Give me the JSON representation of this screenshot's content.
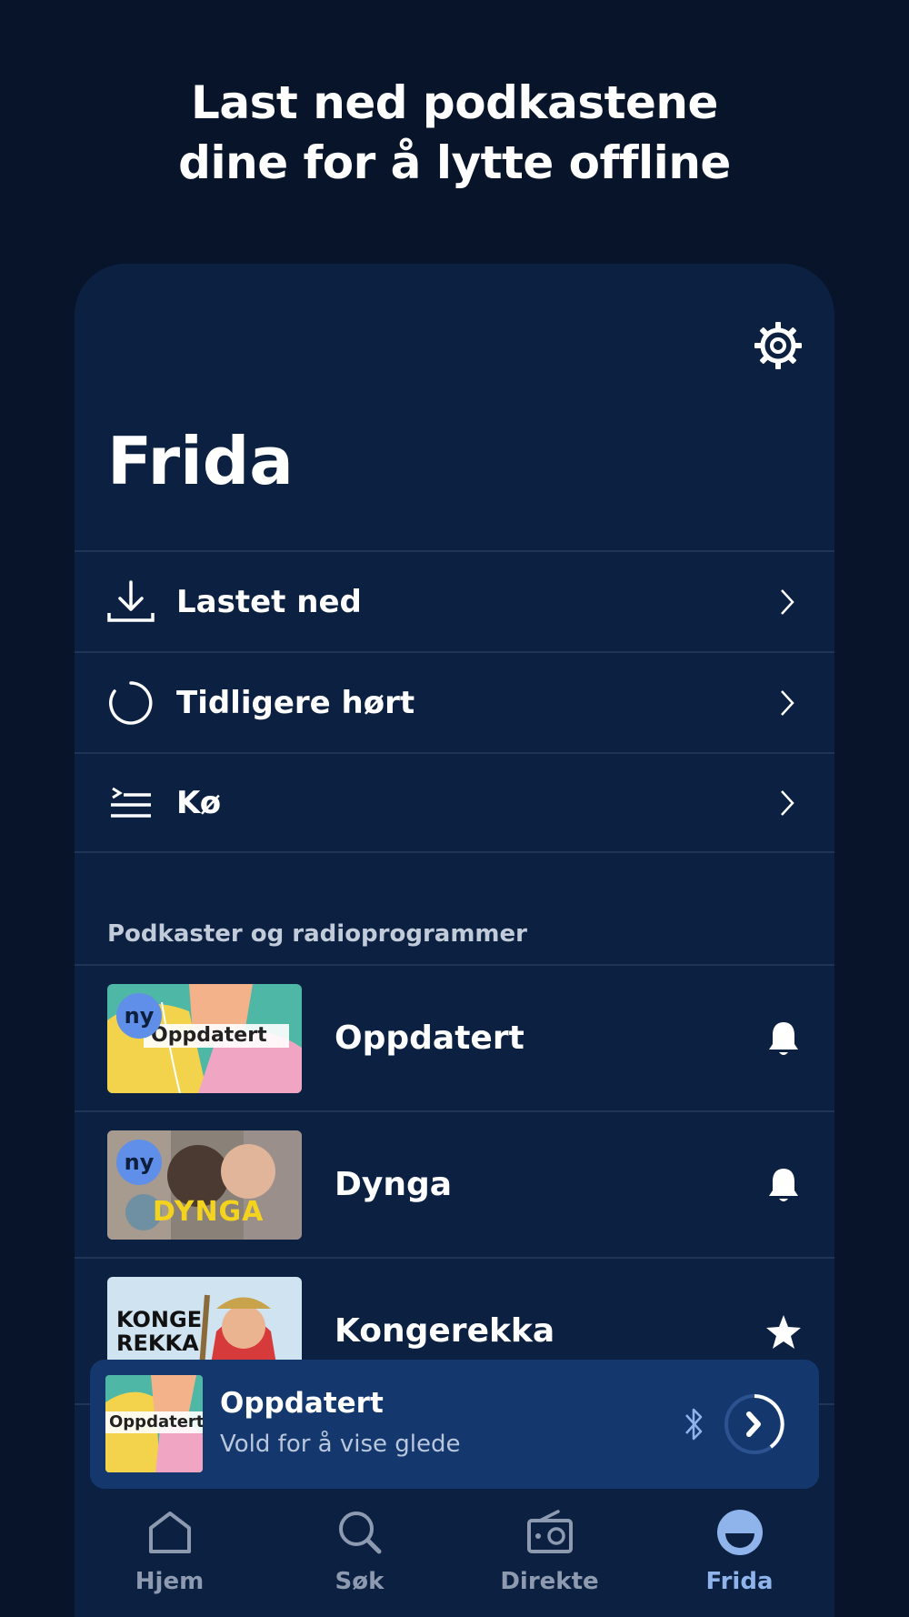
{
  "headline": {
    "line1": "Last ned podkastene",
    "line2": "dine for å lytte offline"
  },
  "profile": {
    "title": "Frida",
    "settings_icon": "gear-icon"
  },
  "menu": [
    {
      "label": "Lastet ned",
      "icon": "download-icon"
    },
    {
      "label": "Tidligere hørt",
      "icon": "history-circle-icon"
    },
    {
      "label": "Kø",
      "icon": "queue-icon"
    }
  ],
  "section_label": "Podkaster og radioprogrammer",
  "podcasts": [
    {
      "title": "Oppdatert",
      "thumb_text": "Oppdatert",
      "badge": "ny",
      "action_icon": "bell-icon"
    },
    {
      "title": "Dynga",
      "thumb_text": "DYNGA",
      "badge": "ny",
      "action_icon": "bell-icon"
    },
    {
      "title": "Kongerekka",
      "thumb_text_1": "KONGE",
      "thumb_text_2": "REKKA",
      "action_icon": "star-icon"
    }
  ],
  "mini_player": {
    "title": "Oppdatert",
    "subtitle": "Vold for å vise glede",
    "thumb_text": "Oppdatert",
    "cast_icon": "bluetooth-icon",
    "play_icon": "play-icon"
  },
  "tabs": [
    {
      "label": "Hjem",
      "icon": "home-icon"
    },
    {
      "label": "Søk",
      "icon": "search-icon"
    },
    {
      "label": "Direkte",
      "icon": "radio-icon"
    },
    {
      "label": "Frida",
      "icon": "profile-icon",
      "active": true
    }
  ],
  "colors": {
    "background": "#07142a",
    "panel": "#0c2142",
    "accent": "#8fb4ec",
    "mini_player": "#14386e"
  }
}
